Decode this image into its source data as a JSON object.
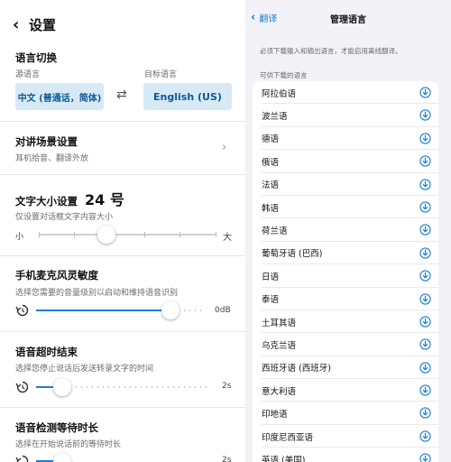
{
  "left": {
    "title": "设置",
    "lang_section": {
      "title": "语言切换",
      "source_label": "源语言",
      "target_label": "目标语言",
      "source_value": "中文 (普通话，简体)",
      "target_value": "English (US)",
      "swap_icon": "swap-arrows-icon"
    },
    "intercom": {
      "title": "对讲场景设置",
      "subtitle": "耳机拾音、翻译外放"
    },
    "text_size": {
      "title": "文字大小设置",
      "value": "24 号",
      "subtitle": "仅设置对话框文字内容大小",
      "min_label": "小",
      "max_label": "大",
      "level_fraction": 0.38
    },
    "mic": {
      "title": "手机麦克风灵敏度",
      "subtitle": "选择您需要的音量级别以启动和维持语音识别",
      "value": "0dB",
      "level_fraction": 0.78
    },
    "timeout": {
      "title": "语音超时结束",
      "subtitle": "选择您停止说话后发送转录文字的时间",
      "value": "2s",
      "level_fraction": 0.14
    },
    "wait": {
      "title": "语音检测等待时长",
      "subtitle": "选择在开始说话前的等待时长",
      "value": "2s",
      "level_fraction": 0.14
    }
  },
  "right": {
    "back_label": "翻译",
    "title": "管理语言",
    "note": "必须下载输入和输出语言，才能启用离线翻译。",
    "section": "可供下载的语言",
    "languages": [
      "阿拉伯语",
      "波兰语",
      "德语",
      "俄语",
      "法语",
      "韩语",
      "荷兰语",
      "葡萄牙语 (巴西)",
      "日语",
      "泰语",
      "土耳其语",
      "乌克兰语",
      "西班牙语 (西班牙)",
      "意大利语",
      "印地语",
      "印度尼西亚语",
      "英语 (美国)"
    ]
  },
  "colors": {
    "accent": "#1b7fd4",
    "lang_box": "#d8e9f6",
    "panel_bg": "#f2f2f7"
  }
}
